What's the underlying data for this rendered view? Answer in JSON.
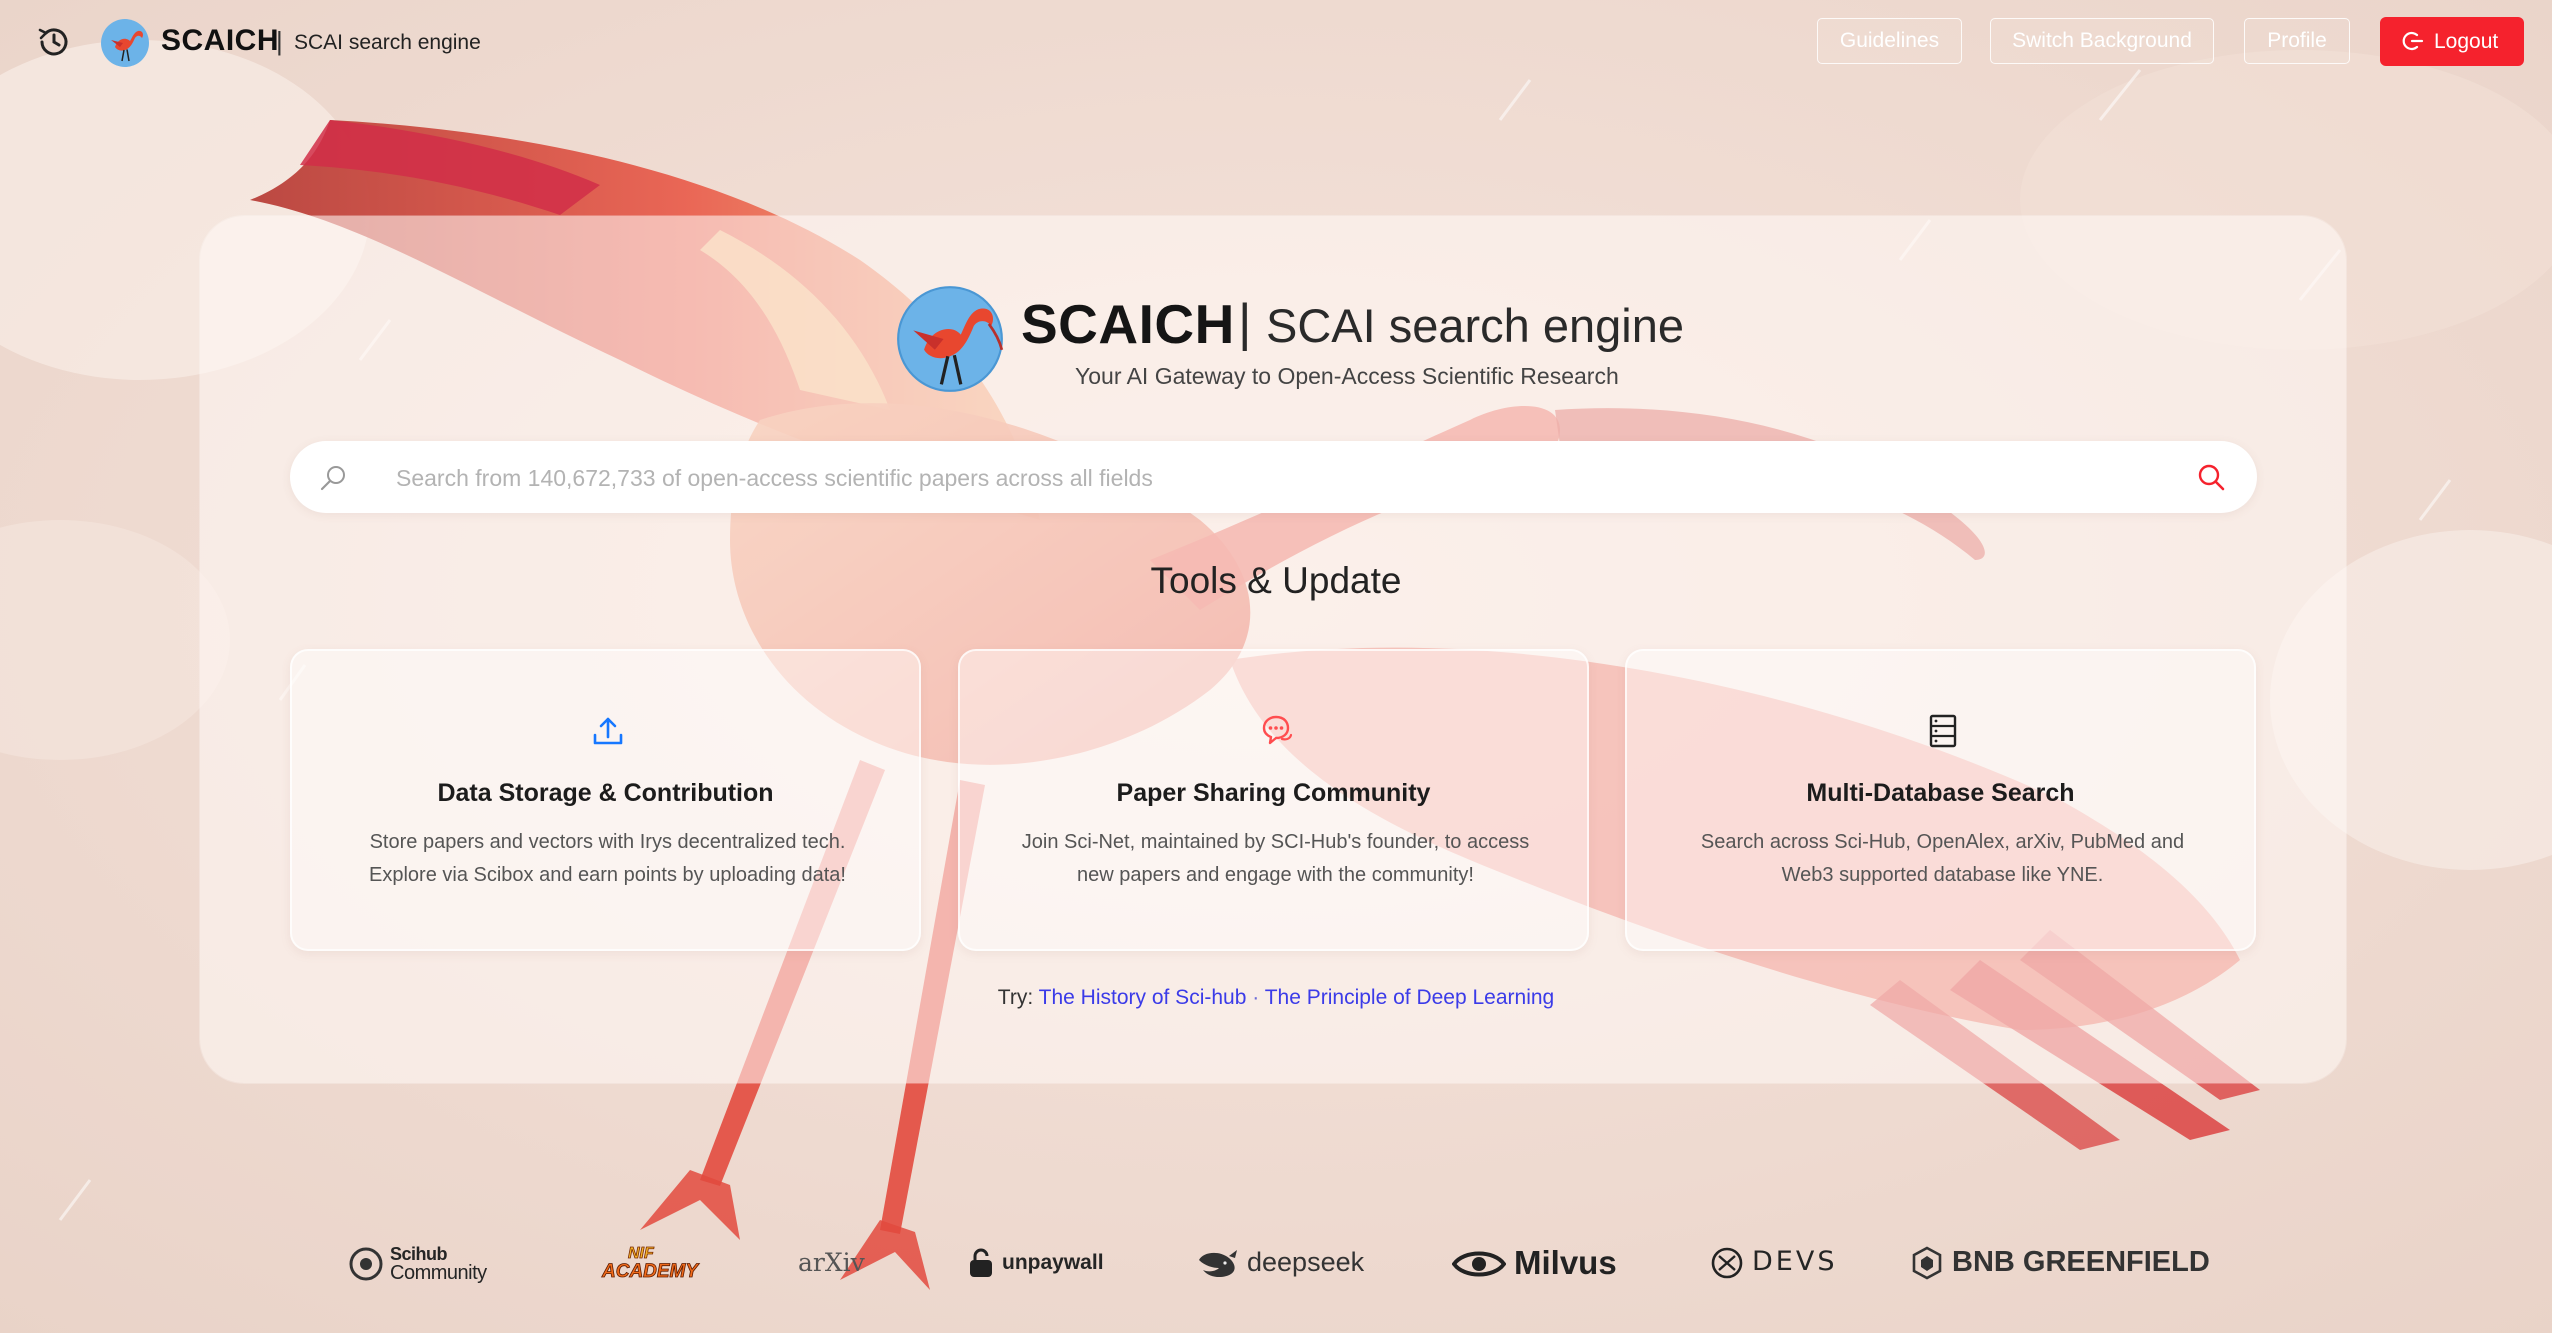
{
  "header": {
    "brand_name": "SCAICH",
    "brand_separator": "|",
    "brand_subtitle": "SCAI search engine",
    "nav": {
      "guidelines": "Guidelines",
      "switch_background": "Switch Background",
      "profile": "Profile",
      "logout": "Logout"
    }
  },
  "hero": {
    "title": "SCAICH",
    "separator": "|",
    "subtitle": "SCAI search engine",
    "tagline": "Your AI Gateway to Open-Access Scientific Research"
  },
  "search": {
    "placeholder": "Search from 140,672,733 of open-access scientific papers across all fields",
    "value": ""
  },
  "tools": {
    "title": "Tools & Update",
    "cards": [
      {
        "icon": "upload-icon",
        "title": "Data Storage & Contribution",
        "desc_line1": "Store papers and vectors with Irys decentralized tech.",
        "desc_line2": "Explore via Scibox and earn points by uploading data!"
      },
      {
        "icon": "chat-bubbles-icon",
        "title": "Paper Sharing Community",
        "desc_line1": "Join Sci-Net, maintained by SCI-Hub's founder, to access",
        "desc_line2": "new papers and engage with the community!"
      },
      {
        "icon": "database-icon",
        "title": "Multi-Database Search",
        "desc_line1": "Search across Sci-Hub, OpenAlex, arXiv, PubMed and",
        "desc_line2": "Web3 supported database like YNE."
      }
    ]
  },
  "try": {
    "label": "Try:",
    "links": [
      "The History of Sci-hub",
      "The Principle of Deep Learning"
    ],
    "separator": "·"
  },
  "partners": [
    {
      "line1": "Scihub",
      "line2": "Community"
    },
    {
      "line1": "NIF",
      "line2": "ACADEMY"
    },
    {
      "name": "arXiv"
    },
    {
      "name": "unpaywall"
    },
    {
      "name": "deepseek"
    },
    {
      "name": "Milvus"
    },
    {
      "name": "DEVS"
    },
    {
      "name": "BNB GREENFIELD"
    }
  ],
  "colors": {
    "accent_red": "#f5222d",
    "link_blue": "#3b3be8",
    "upload_icon": "#1677ff",
    "chat_icon": "#ff4d4f"
  }
}
